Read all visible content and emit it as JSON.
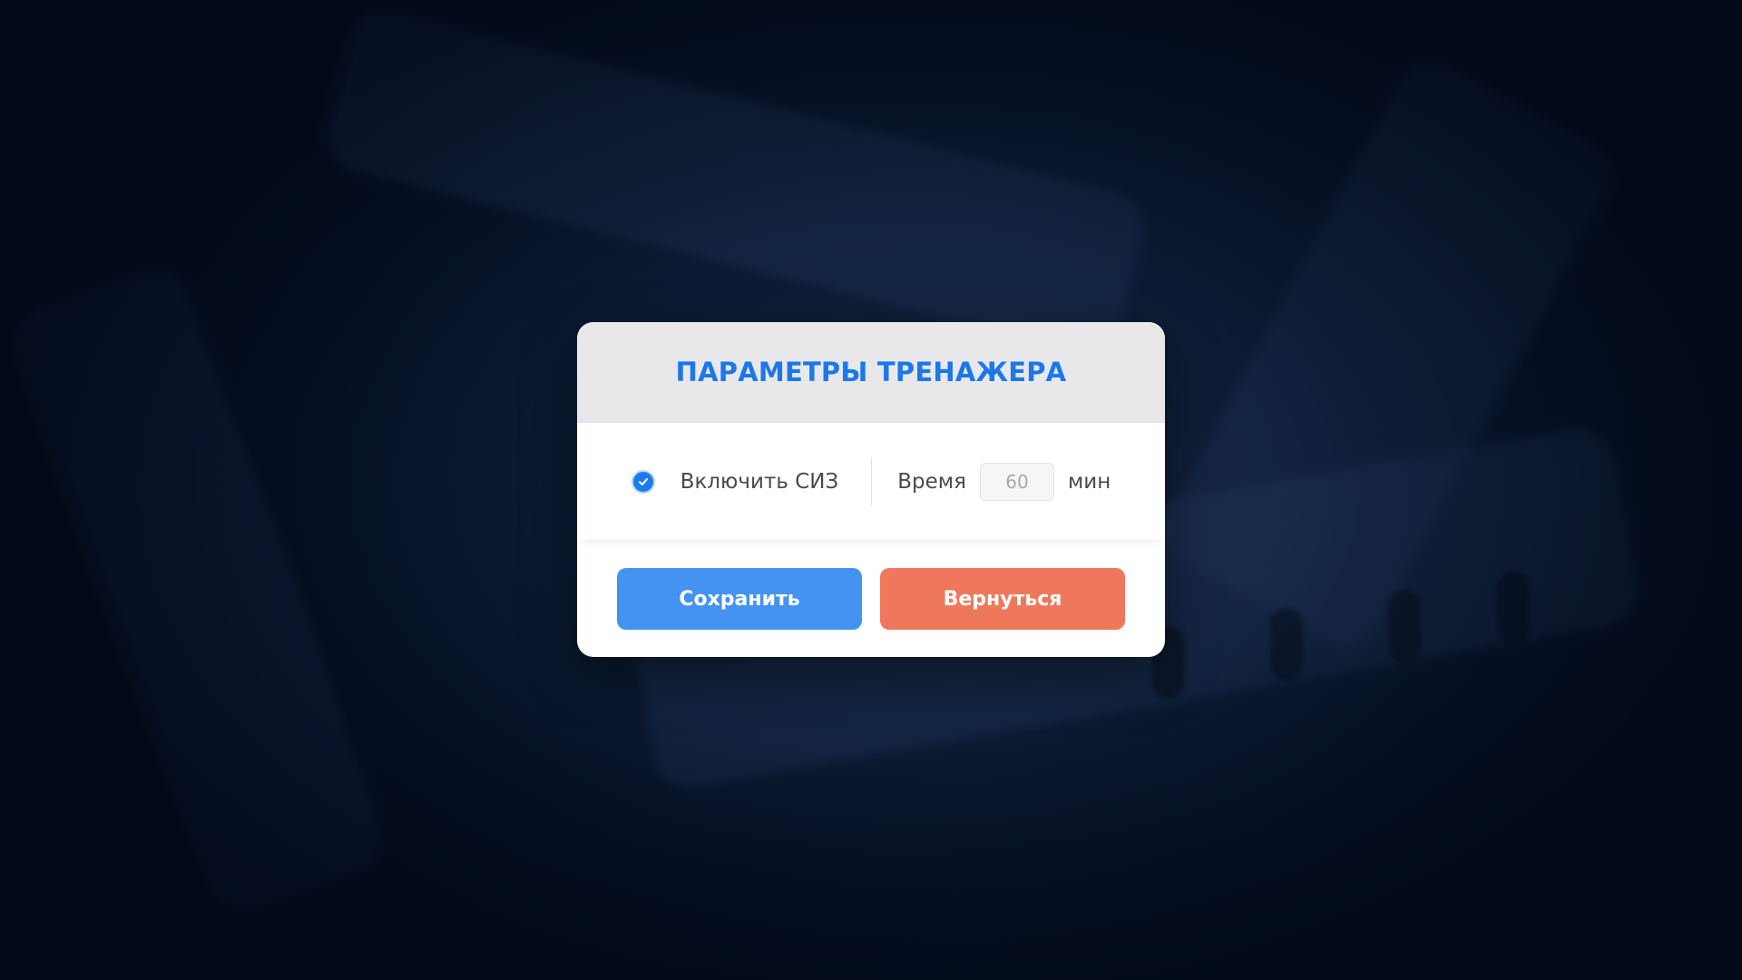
{
  "dialog": {
    "title": "ПАРАМЕТРЫ ТРЕНАЖЕРА",
    "ppe_option": {
      "label": "Включить СИЗ",
      "checked": true
    },
    "time": {
      "label": "Время",
      "value": "60",
      "unit": "мин"
    },
    "buttons": {
      "save_label": "Сохранить",
      "back_label": "Вернуться"
    }
  },
  "colors": {
    "title": "#1c78ea",
    "checkbox": "#1f7be8",
    "save_button": "#4493f0",
    "back_button": "#ef785c",
    "header_bg": "#e8e8ea"
  },
  "icons": {
    "checkbox": "check-icon"
  }
}
